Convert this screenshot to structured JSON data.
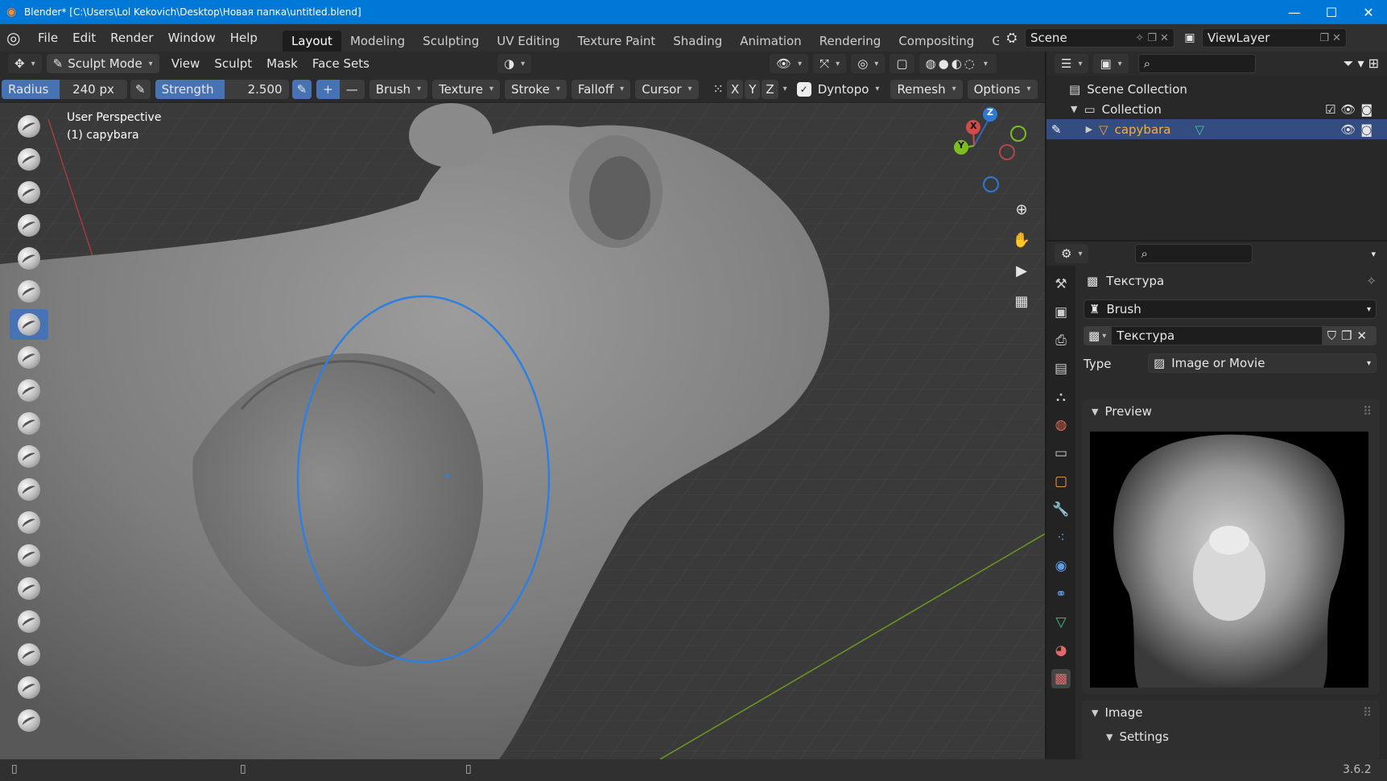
{
  "titlebar": {
    "title": "Blender* [C:\\Users\\Lol Kekovich\\Desktop\\Новая папка\\untitled.blend]",
    "minimize": "—",
    "maximize": "☐",
    "close": "✕"
  },
  "menu": [
    "File",
    "Edit",
    "Render",
    "Window",
    "Help"
  ],
  "workspaces": [
    "Layout",
    "Modeling",
    "Sculpting",
    "UV Editing",
    "Texture Paint",
    "Shading",
    "Animation",
    "Rendering",
    "Compositing",
    "Geomet"
  ],
  "scene": {
    "label": "Scene",
    "viewlayer": "ViewLayer"
  },
  "header": {
    "mode": "Sculpt Mode",
    "menus": [
      "View",
      "Sculpt",
      "Mask",
      "Face Sets"
    ]
  },
  "tool": {
    "radius_label": "Radius",
    "radius_value": "240 px",
    "strength_label": "Strength",
    "strength_value": "2.500",
    "plus": "+",
    "minus": "—",
    "menus": [
      "Brush",
      "Texture",
      "Stroke",
      "Falloff",
      "Cursor"
    ],
    "axes": [
      "X",
      "Y",
      "Z"
    ],
    "dyntopo": "Dyntopo",
    "remesh": "Remesh",
    "options": "Options"
  },
  "viewport": {
    "perspective": "User Perspective",
    "object": "(1) capybara",
    "gizmo": {
      "x": "X",
      "y": "Y",
      "z": "Z"
    }
  },
  "outliner": {
    "scene_collection": "Scene Collection",
    "collection": "Collection",
    "object": "capybara"
  },
  "properties": {
    "tab_title": "Текстура",
    "brush": "Brush",
    "texture_name": "Текстура",
    "type_label": "Type",
    "type_value": "Image or Movie",
    "preview": "Preview",
    "image": "Image",
    "settings": "Settings"
  },
  "status": {
    "version": "3.6.2"
  },
  "colors": {
    "accent": "#4772b3",
    "brush_circle": "#2f7fe0",
    "title_bar": "#0078d7"
  }
}
